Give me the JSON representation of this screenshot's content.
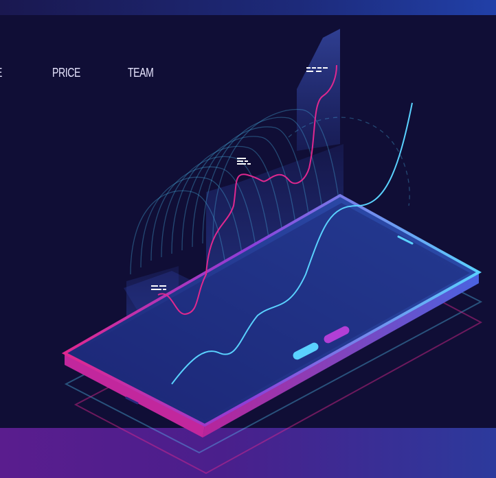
{
  "nav": {
    "items": [
      {
        "label": "E"
      },
      {
        "label": "PRICE"
      },
      {
        "label": "TEAM"
      }
    ]
  },
  "illustration": {
    "description_icon": "isometric-phone-analytics-illustration",
    "colors": {
      "background": "#100e36",
      "cyan_accent": "#5ad2ff",
      "magenta_accent": "#e0288f",
      "purple_accent": "#8b3fd9",
      "panel_blue": "#2a3d9a"
    },
    "tags": [
      {
        "icon": "chart-label-glyph"
      },
      {
        "icon": "chart-label-glyph"
      },
      {
        "icon": "chart-label-glyph"
      }
    ]
  }
}
